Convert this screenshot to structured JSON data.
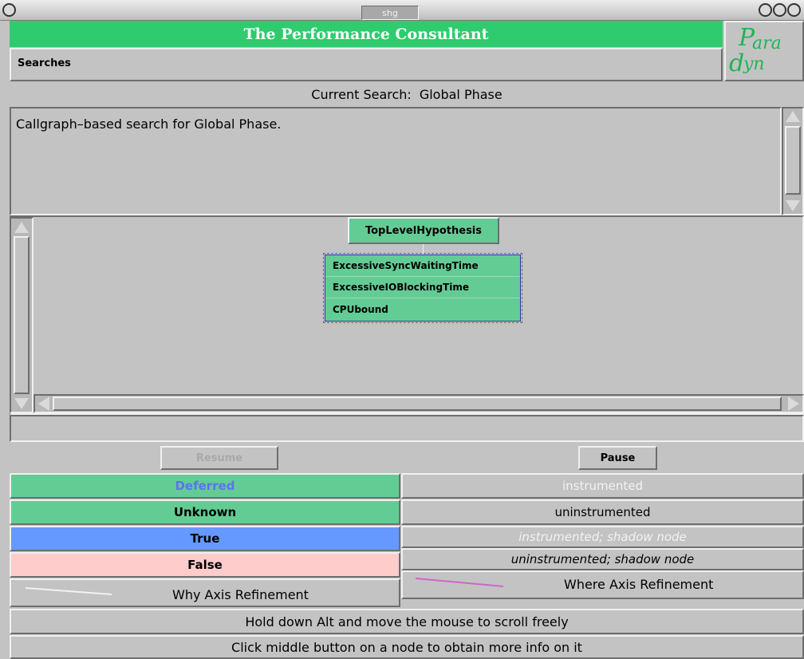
{
  "window": {
    "title": "shg"
  },
  "header": {
    "title": "The Performance Consultant",
    "logo_text": "ParaDyn"
  },
  "menu": {
    "searches": "Searches"
  },
  "search": {
    "label": "Current Search:",
    "value": "Global Phase"
  },
  "message": "Callgraph–based search for Global Phase.",
  "graph": {
    "root": "TopLevelHypothesis",
    "children": [
      "ExcessiveSyncWaitingTime",
      "ExcessiveIOBlockingTime",
      "CPUbound"
    ]
  },
  "buttons": {
    "resume": "Resume",
    "pause": "Pause"
  },
  "legend": {
    "deferred": "Deferred",
    "unknown": "Unknown",
    "true": "True",
    "false": "False",
    "why": "Why Axis Refinement",
    "instrumented": "instrumented",
    "uninstrumented": "uninstrumented",
    "instrumented_shadow": "instrumented; shadow node",
    "uninstrumented_shadow": "uninstrumented; shadow node",
    "where": "Where Axis Refinement"
  },
  "hints": {
    "scroll": "Hold down Alt and move the mouse to scroll freely",
    "info": "Click middle button on a node to obtain more info on it"
  },
  "colors": {
    "title_green": "#2ecc6e",
    "node_green": "#63cc95",
    "true_blue": "#6699ff",
    "false_pink": "#ffcccc",
    "deferred_text": "#5b74ee",
    "where_line": "#cc66cc",
    "why_line": "#f2f2f2"
  }
}
